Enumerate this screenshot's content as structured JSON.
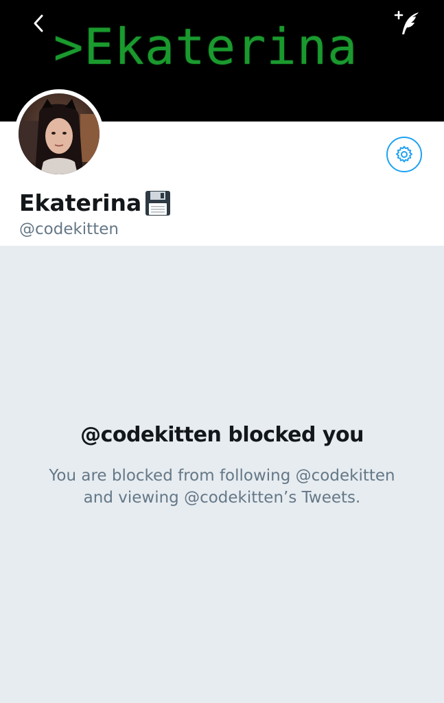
{
  "header": {
    "banner_text": ">Ekaterina",
    "back_icon": "chevron-left-icon",
    "compose_icon": "compose-tweet-icon"
  },
  "profile": {
    "display_name": "Ekaterina",
    "name_emoji": "floppy-disk-icon",
    "handle": "@codekitten",
    "settings_icon": "gear-icon"
  },
  "blocked": {
    "title": "@codekitten blocked you",
    "description": "You are blocked from following @codekitten and viewing @codekitten’s Tweets."
  },
  "colors": {
    "banner_bg": "#000000",
    "banner_text": "#1a9a2e",
    "accent": "#1da1f2",
    "page_bg": "#e6ecf0",
    "primary_text": "#14171a",
    "secondary_text": "#657786"
  }
}
